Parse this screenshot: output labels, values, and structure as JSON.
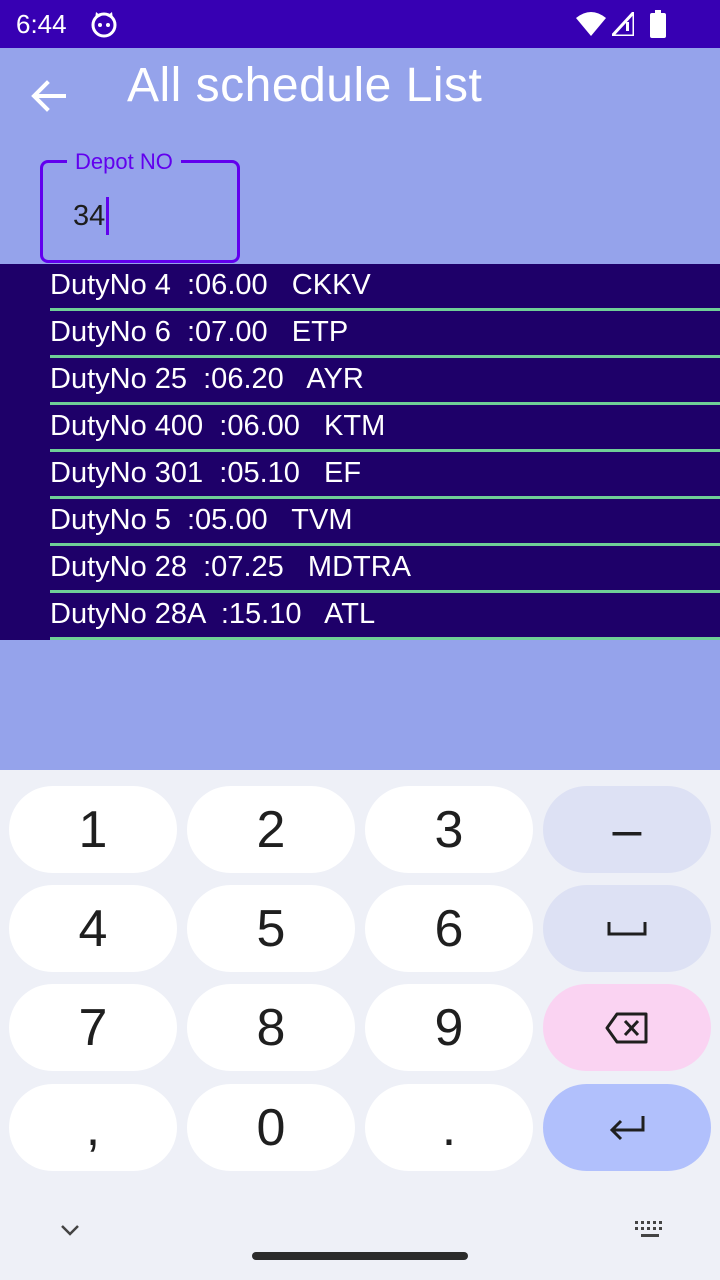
{
  "status_bar": {
    "time": "6:44"
  },
  "app_bar": {
    "title": "All schedule List"
  },
  "depot_input": {
    "label": "Depot NO",
    "value": "34"
  },
  "schedules": [
    {
      "text": "DutyNo 4  :06.00   CKKV"
    },
    {
      "text": "DutyNo 6  :07.00   ETP"
    },
    {
      "text": "DutyNo 25  :06.20   AYR"
    },
    {
      "text": "DutyNo 400  :06.00   KTM"
    },
    {
      "text": "DutyNo 301  :05.10   EF"
    },
    {
      "text": "DutyNo 5  :05.00   TVM"
    },
    {
      "text": "DutyNo 28  :07.25   MDTRA"
    },
    {
      "text": "DutyNo 28A  :15.10   ATL"
    }
  ],
  "keyboard": {
    "keys": [
      "1",
      "2",
      "3",
      "–",
      "4",
      "5",
      "6",
      "␣",
      "7",
      "8",
      "9",
      "backspace",
      ",",
      "0",
      ".",
      "enter"
    ],
    "k1": "1",
    "k2": "2",
    "k3": "3",
    "dash": "–",
    "k4": "4",
    "k5": "5",
    "k6": "6",
    "k7": "7",
    "k8": "8",
    "k9": "9",
    "comma": ",",
    "k0": "0",
    "dot": "."
  },
  "colors": {
    "status_bar": "#3700b3",
    "background": "#95a3eb",
    "list_bg": "#1e0069",
    "divider": "#6fcf97",
    "accent": "#6200ee"
  }
}
